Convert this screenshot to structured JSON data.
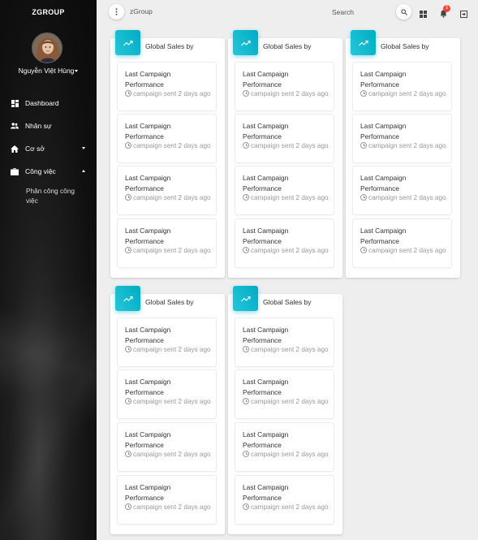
{
  "sidebar": {
    "brand": "ZGROUP",
    "username": "Nguyễn Việt Hùng",
    "items": [
      {
        "label": "Dashboard",
        "icon": "dashboard-icon"
      },
      {
        "label": "Nhân sự",
        "icon": "people-icon"
      },
      {
        "label": "Cơ sở",
        "icon": "home-icon"
      },
      {
        "label": "Công việc",
        "icon": "briefcase-icon"
      }
    ],
    "sub_item": "Phân công công việc"
  },
  "topbar": {
    "menu_icon": "more-vert-icon",
    "title": "zGroup",
    "search_label": "Search",
    "search_icon": "search-icon",
    "apps_icon": "apps-icon",
    "notification_icon": "bell-icon",
    "notification_count": "5",
    "logout_icon": "logout-icon"
  },
  "colors": {
    "accent": "#00acc1",
    "badge": "#f44336",
    "sidebar_bg": "#111111",
    "page_bg": "#eeeeee"
  },
  "cards": [
    {
      "title": "Global Sales by",
      "icon": "trending-up-icon",
      "items": [
        {
          "title": "Last Campaign Performance",
          "sub": "campaign sent 2 days ago"
        },
        {
          "title": "Last Campaign Performance",
          "sub": "campaign sent 2 days ago"
        },
        {
          "title": "Last Campaign Performance",
          "sub": "campaign sent 2 days ago"
        },
        {
          "title": "Last Campaign Performance",
          "sub": "campaign sent 2 days ago"
        }
      ]
    },
    {
      "title": "Global Sales by",
      "icon": "trending-up-icon",
      "items": [
        {
          "title": "Last Campaign Performance",
          "sub": "campaign sent 2 days ago"
        },
        {
          "title": "Last Campaign Performance",
          "sub": "campaign sent 2 days ago"
        },
        {
          "title": "Last Campaign Performance",
          "sub": "campaign sent 2 days ago"
        },
        {
          "title": "Last Campaign Performance",
          "sub": "campaign sent 2 days ago"
        }
      ]
    },
    {
      "title": "Global Sales by",
      "icon": "trending-up-icon",
      "items": [
        {
          "title": "Last Campaign Performance",
          "sub": "campaign sent 2 days ago"
        },
        {
          "title": "Last Campaign Performance",
          "sub": "campaign sent 2 days ago"
        },
        {
          "title": "Last Campaign Performance",
          "sub": "campaign sent 2 days ago"
        },
        {
          "title": "Last Campaign Performance",
          "sub": "campaign sent 2 days ago"
        }
      ]
    },
    {
      "title": "Global Sales by",
      "icon": "trending-up-icon",
      "items": [
        {
          "title": "Last Campaign Performance",
          "sub": "campaign sent 2 days ago"
        },
        {
          "title": "Last Campaign Performance",
          "sub": "campaign sent 2 days ago"
        },
        {
          "title": "Last Campaign Performance",
          "sub": "campaign sent 2 days ago"
        },
        {
          "title": "Last Campaign Performance",
          "sub": "campaign sent 2 days ago"
        }
      ]
    },
    {
      "title": "Global Sales by",
      "icon": "trending-up-icon",
      "items": [
        {
          "title": "Last Campaign Performance",
          "sub": "campaign sent 2 days ago"
        },
        {
          "title": "Last Campaign Performance",
          "sub": "campaign sent 2 days ago"
        },
        {
          "title": "Last Campaign Performance",
          "sub": "campaign sent 2 days ago"
        },
        {
          "title": "Last Campaign Performance",
          "sub": "campaign sent 2 days ago"
        }
      ]
    }
  ]
}
